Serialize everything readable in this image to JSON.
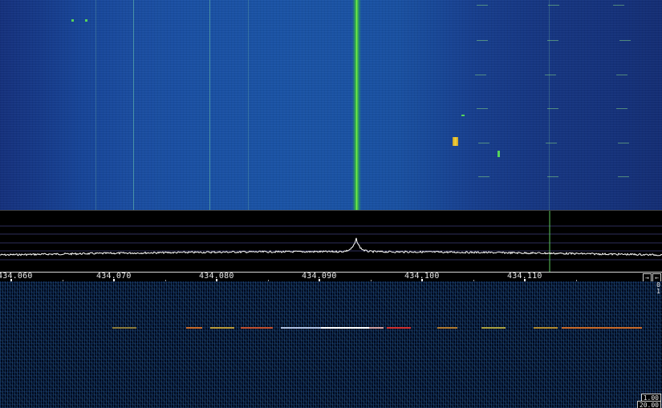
{
  "frequency_scale": {
    "labels": [
      "434.060",
      "434.070",
      "434.080",
      "434.090",
      "434.100",
      "434.110"
    ],
    "buttons": [
      "→",
      "←"
    ]
  },
  "side_scale": {
    "top_values": [
      "0",
      "1"
    ]
  },
  "bottom_panel": {
    "gain": "1.00",
    "range": "20.00"
  },
  "colors": {
    "waterfall_background": "#1b52a6",
    "carrier": "#8df55a",
    "spectrum_trace": "#ffffff",
    "marker": "#5cc85c"
  }
}
